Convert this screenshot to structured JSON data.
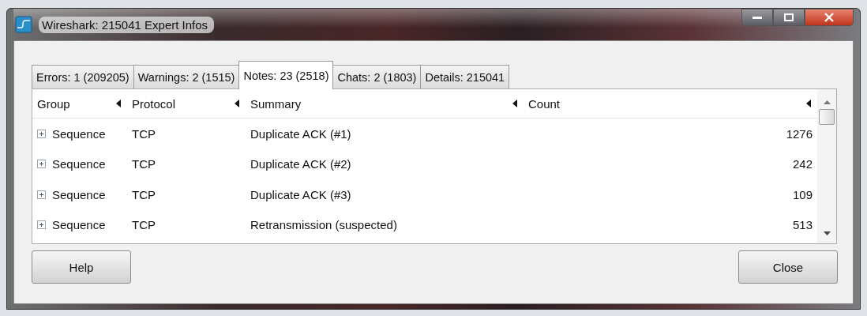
{
  "window": {
    "title": "Wireshark: 215041 Expert Infos"
  },
  "tabs": [
    {
      "label": "Errors: 1 (209205)",
      "selected": false
    },
    {
      "label": "Warnings: 2 (1515)",
      "selected": false
    },
    {
      "label": "Notes: 23 (2518)",
      "selected": true
    },
    {
      "label": "Chats: 2 (1803)",
      "selected": false
    },
    {
      "label": "Details: 215041",
      "selected": false
    }
  ],
  "table": {
    "columns": [
      "Group",
      "Protocol",
      "Summary",
      "Count"
    ],
    "rows": [
      {
        "group": "Sequence",
        "protocol": "TCP",
        "summary": "Duplicate ACK (#1)",
        "count": "1276",
        "expanded": false
      },
      {
        "group": "Sequence",
        "protocol": "TCP",
        "summary": "Duplicate ACK (#2)",
        "count": "242",
        "expanded": false
      },
      {
        "group": "Sequence",
        "protocol": "TCP",
        "summary": "Duplicate ACK (#3)",
        "count": "109",
        "expanded": false
      },
      {
        "group": "Sequence",
        "protocol": "TCP",
        "summary": "Retransmission (suspected)",
        "count": "513",
        "expanded": false
      }
    ]
  },
  "buttons": [
    "Help",
    "Close"
  ]
}
